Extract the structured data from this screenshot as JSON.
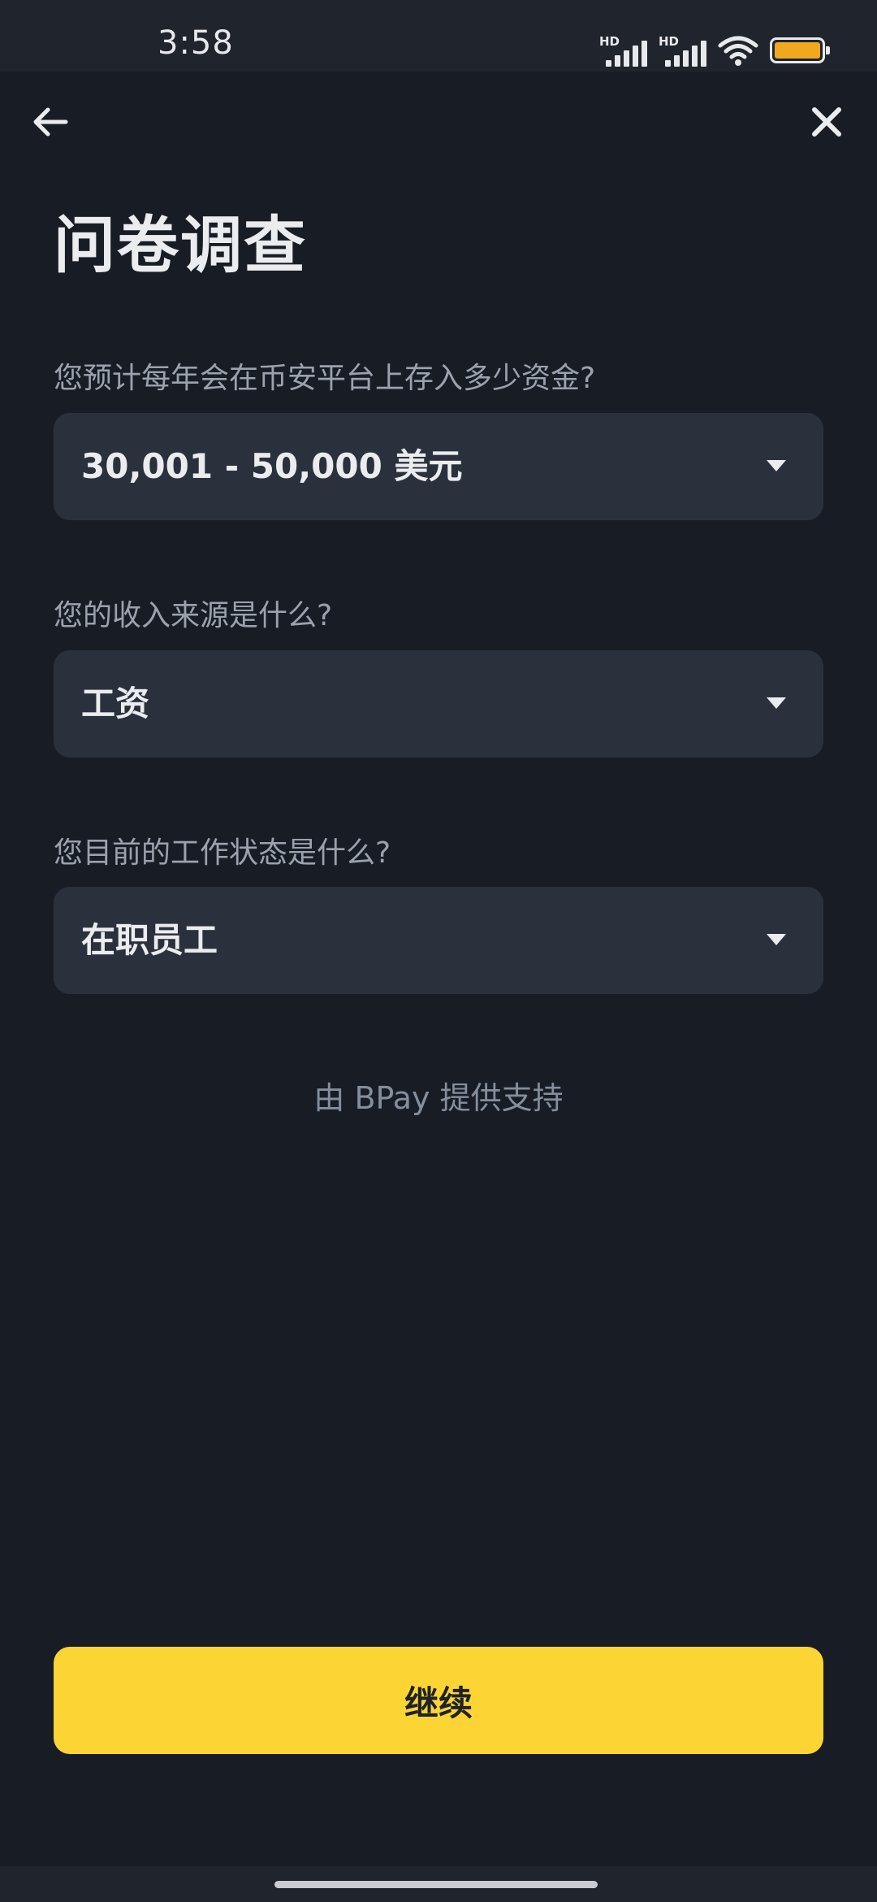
{
  "status_bar": {
    "time": "3:58",
    "signal1_label": "HD",
    "signal2_label": "HD",
    "battery_color": "#f0a91e"
  },
  "nav": {
    "back_icon": "arrow-left-icon",
    "close_icon": "close-icon"
  },
  "page": {
    "title": "问卷调查"
  },
  "questions": [
    {
      "label": "您预计每年会在币安平台上存入多少资金?",
      "selected": "30,001 - 50,000 美元"
    },
    {
      "label": "您的收入来源是什么?",
      "selected": "工资"
    },
    {
      "label": "您目前的工作状态是什么?",
      "selected": "在职员工"
    }
  ],
  "footer": {
    "powered_by": "由 BPay 提供支持",
    "continue_label": "继续"
  },
  "colors": {
    "background": "#181d25",
    "field_bg": "#2b313c",
    "accent": "#fcd535"
  }
}
